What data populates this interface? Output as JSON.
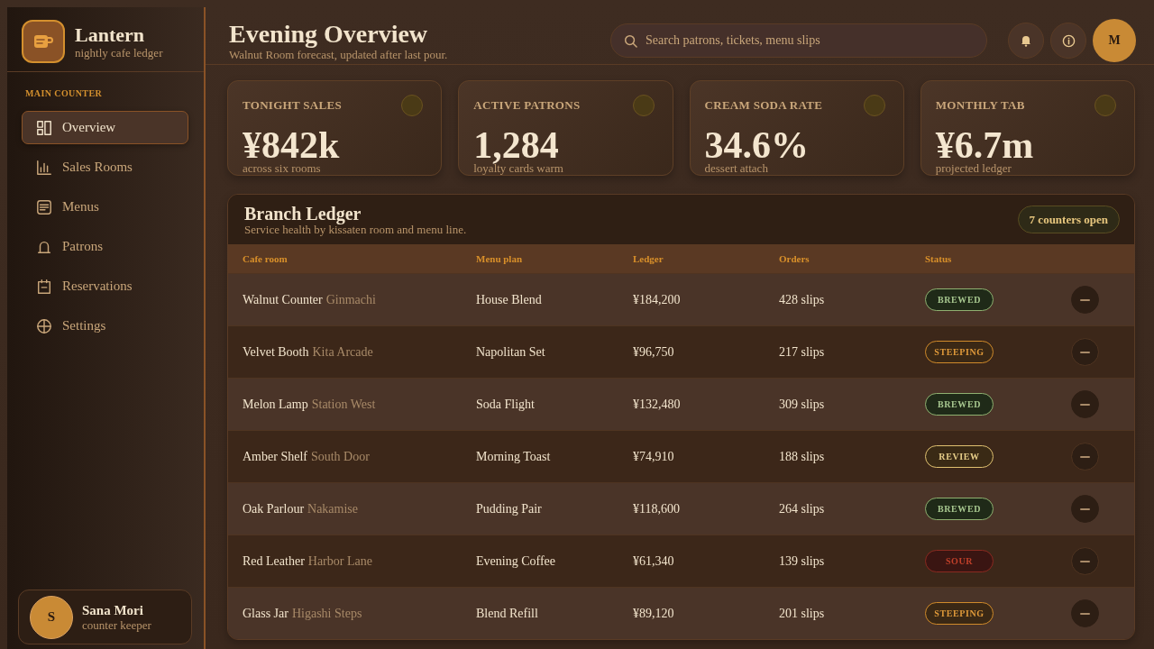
{
  "sidebar": {
    "brand": {
      "name": "Lantern",
      "tagline": "nightly cafe ledger"
    },
    "section_label": "MAIN COUNTER",
    "items": [
      {
        "label": "Overview",
        "selected": true
      },
      {
        "label": "Sales Rooms",
        "selected": false
      },
      {
        "label": "Menus",
        "selected": false
      },
      {
        "label": "Patrons",
        "selected": false
      },
      {
        "label": "Reservations",
        "selected": false
      },
      {
        "label": "Settings",
        "selected": false
      }
    ],
    "user": {
      "initial": "S",
      "name": "Sana Mori",
      "role": "counter keeper"
    }
  },
  "header": {
    "title": "Evening Overview",
    "subtitle": "Walnut Room forecast, updated after last pour.",
    "search": {
      "placeholder": "Search patrons, tickets, menu slips"
    },
    "avatar": {
      "initial": "M"
    }
  },
  "stats": [
    {
      "label": "TONIGHT SALES",
      "value": "¥842k",
      "note": "across six rooms"
    },
    {
      "label": "ACTIVE PATRONS",
      "value": "1,284",
      "note": "loyalty cards warm"
    },
    {
      "label": "CREAM SODA RATE",
      "value": "34.6%",
      "note": "dessert attach"
    },
    {
      "label": "MONTHLY TAB",
      "value": "¥6.7m",
      "note": "projected ledger"
    }
  ],
  "ledger": {
    "title": "Branch Ledger",
    "subtitle": "Service health by kissaten room and menu line.",
    "badge": "7 counters open",
    "columns": [
      "Cafe room",
      "Menu plan",
      "Ledger",
      "Orders",
      "Status"
    ],
    "rows": [
      {
        "room": "Walnut Counter",
        "area": "Ginmachi",
        "menu": "House Blend",
        "ledger": "¥184,200",
        "orders": "428 slips",
        "status": {
          "label": "BREWED",
          "kind": "brewed"
        }
      },
      {
        "room": "Velvet Booth",
        "area": "Kita Arcade",
        "menu": "Napolitan Set",
        "ledger": "¥96,750",
        "orders": "217 slips",
        "status": {
          "label": "STEEPING",
          "kind": "steeping"
        }
      },
      {
        "room": "Melon Lamp",
        "area": "Station West",
        "menu": "Soda Flight",
        "ledger": "¥132,480",
        "orders": "309 slips",
        "status": {
          "label": "BREWED",
          "kind": "brewed"
        }
      },
      {
        "room": "Amber Shelf",
        "area": "South Door",
        "menu": "Morning Toast",
        "ledger": "¥74,910",
        "orders": "188 slips",
        "status": {
          "label": "REVIEW",
          "kind": "review"
        }
      },
      {
        "room": "Oak Parlour",
        "area": "Nakamise",
        "menu": "Pudding Pair",
        "ledger": "¥118,600",
        "orders": "264 slips",
        "status": {
          "label": "BREWED",
          "kind": "brewed"
        }
      },
      {
        "room": "Red Leather",
        "area": "Harbor Lane",
        "menu": "Evening Coffee",
        "ledger": "¥61,340",
        "orders": "139 slips",
        "status": {
          "label": "SOUR",
          "kind": "sour"
        }
      },
      {
        "room": "Glass Jar",
        "area": "Higashi Steps",
        "menu": "Blend Refill",
        "ledger": "¥89,120",
        "orders": "201 slips",
        "status": {
          "label": "STEEPING",
          "kind": "steeping"
        }
      }
    ]
  }
}
